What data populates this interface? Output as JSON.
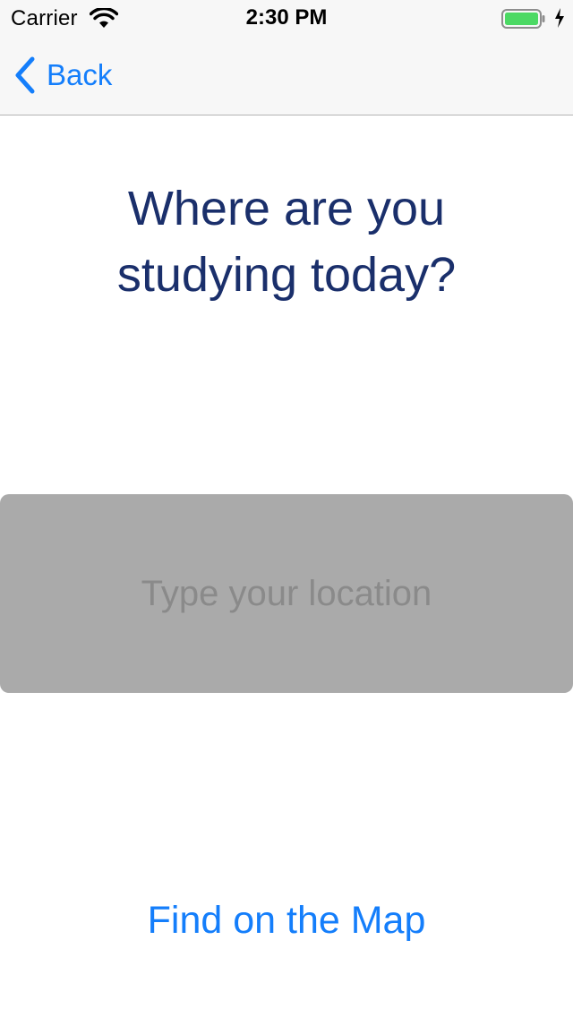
{
  "status_bar": {
    "carrier": "Carrier",
    "time": "2:30 PM",
    "wifi_icon": "wifi-icon",
    "battery_icon": "battery-icon",
    "charging_icon": "charging-bolt-icon"
  },
  "nav": {
    "back_label": "Back",
    "back_icon": "chevron-left-icon"
  },
  "main": {
    "heading": "Where are you studying today?",
    "location_placeholder": "Type your location",
    "location_value": "",
    "map_button_label": "Find on the Map"
  },
  "colors": {
    "accent": "#147efb",
    "heading": "#1a2f6b",
    "field_background": "#aaaaaa",
    "placeholder": "#8a8a8a",
    "bar_background": "#f7f7f7",
    "battery_fill": "#4cd964"
  }
}
